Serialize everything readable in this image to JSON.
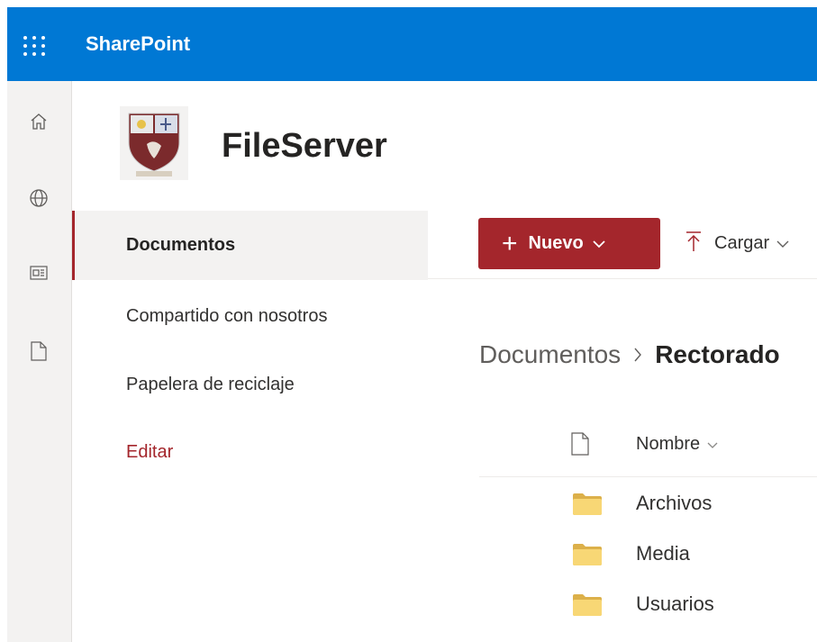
{
  "suite": {
    "title": "SharePoint"
  },
  "app_bar": {
    "icons": [
      "home-icon",
      "globe-icon",
      "news-icon",
      "document-icon"
    ]
  },
  "site": {
    "title": "FileServer"
  },
  "nav": {
    "items": [
      {
        "label": "Documentos"
      },
      {
        "label": "Compartido con nosotros"
      },
      {
        "label": "Papelera de reciclaje"
      },
      {
        "label": "Editar"
      }
    ]
  },
  "commands": {
    "new_label": "Nuevo",
    "upload_label": "Cargar"
  },
  "breadcrumb": {
    "root": "Documentos",
    "current": "Rectorado"
  },
  "list": {
    "header_name": "Nombre",
    "rows": [
      {
        "name": "Archivos",
        "type": "folder"
      },
      {
        "name": "Media",
        "type": "folder"
      },
      {
        "name": "Usuarios",
        "type": "folder"
      }
    ]
  },
  "colors": {
    "suite_bar": "#0078d4",
    "accent": "#a4262c",
    "folder": "#f8d775"
  }
}
